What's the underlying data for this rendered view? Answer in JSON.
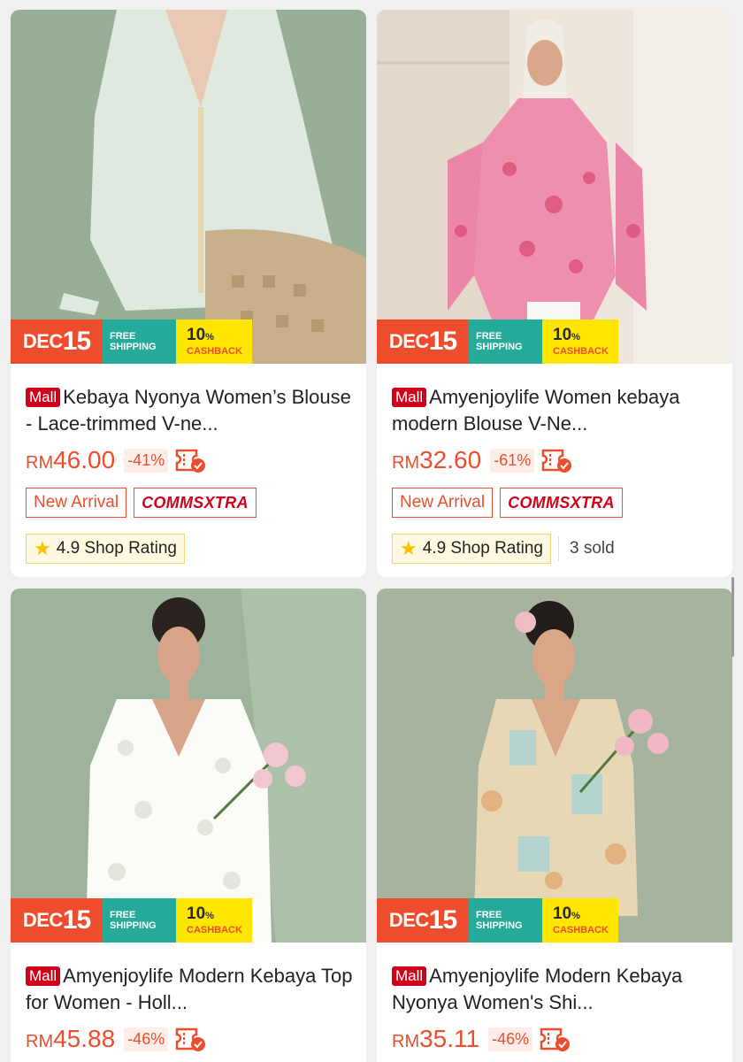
{
  "promo": {
    "dec_month": "DEC",
    "dec_day": "15",
    "free_line1": "FREE",
    "free_line2": "SHIPPING",
    "cashback_pct": "10",
    "cashback_pct_sign": "%",
    "cashback_label": "CASHBACK"
  },
  "mall_label": "Mall",
  "currency": "RM",
  "products": [
    {
      "title": "Kebaya Nyonya Women’s Blouse - Lace-trimmed V-ne...",
      "price": "46.00",
      "discount": "-41%",
      "tag_new": "New Arrival",
      "tag_comms": "COMMSXTRA",
      "rating": "4.9 Shop Rating",
      "sold": ""
    },
    {
      "title": "Amyenjoylife Women kebaya modern Blouse V-Ne...",
      "price": "32.60",
      "discount": "-61%",
      "tag_new": "New Arrival",
      "tag_comms": "COMMSXTRA",
      "rating": "4.9 Shop Rating",
      "sold": "3 sold"
    },
    {
      "title": "Amyenjoylife Modern Kebaya Top for Women - Holl...",
      "price": "45.88",
      "discount": "-46%"
    },
    {
      "title": "Amyenjoylife Modern Kebaya Nyonya Women's Shi...",
      "price": "35.11",
      "discount": "-46%"
    }
  ],
  "icons": {
    "coupon": "coupon-check-icon",
    "star": "star-icon"
  },
  "colors": {
    "brand": "#ee4d2d",
    "mall": "#d0011b",
    "free_shipping": "#26aa99",
    "cashback": "#ffe600"
  }
}
